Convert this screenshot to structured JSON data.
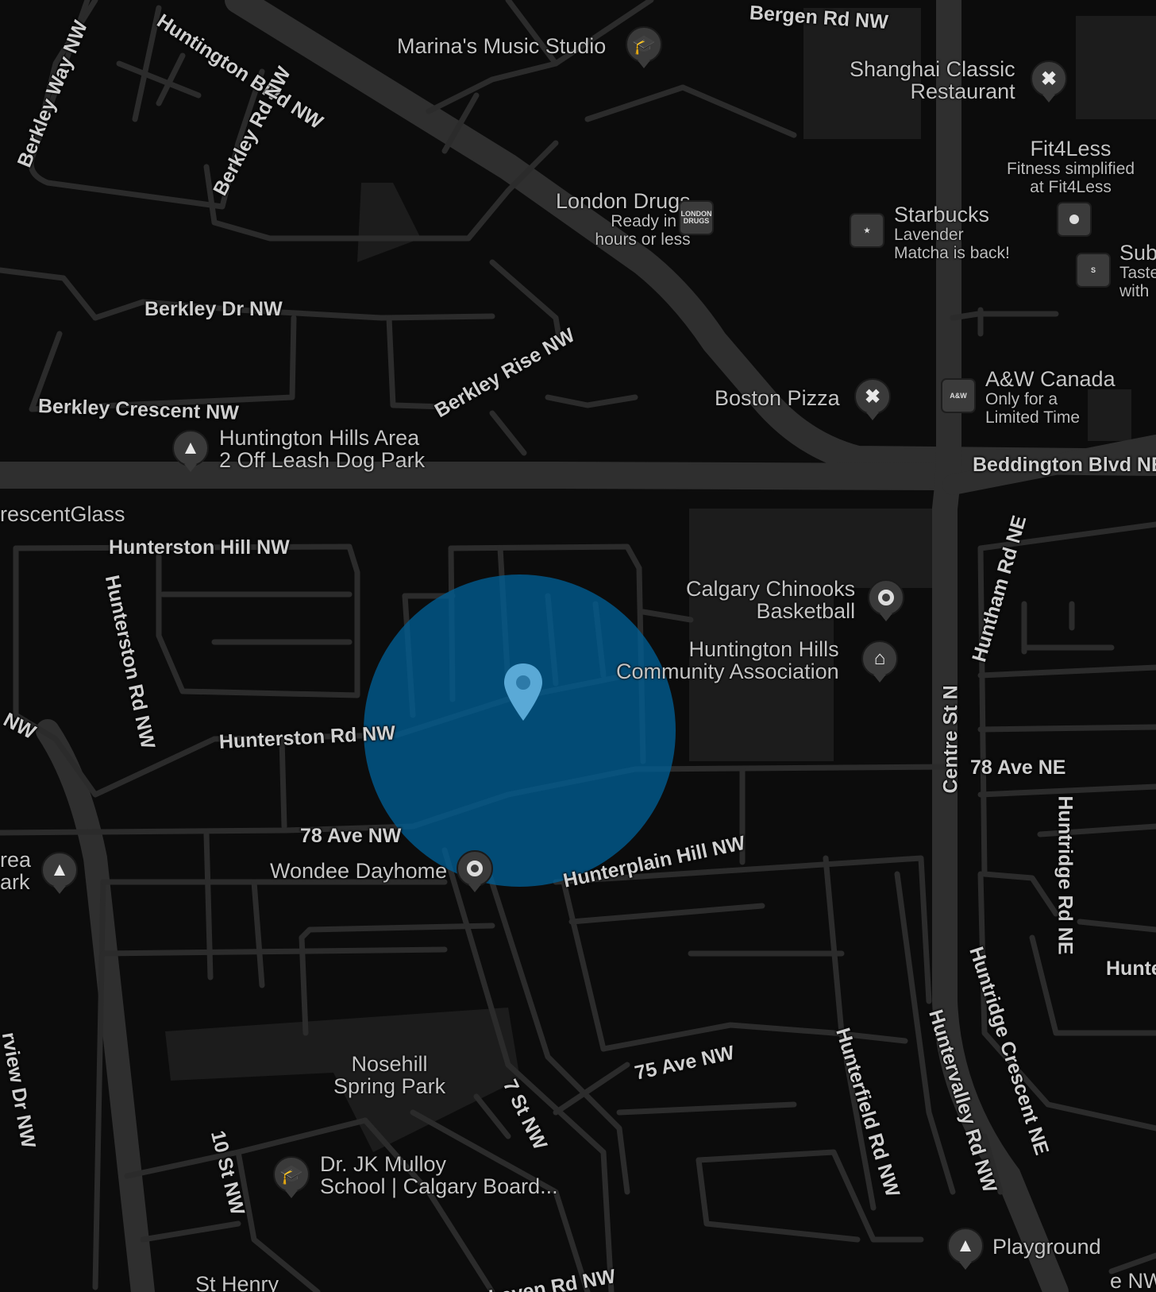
{
  "colors": {
    "background": "#0c0c0c",
    "road": "#262626",
    "arterial": "#2e2e2e",
    "block": "#1a1a1a",
    "accuracy_circle": "#005d94",
    "location_pin": "#5aa9d6",
    "label": "#cfcfcf"
  },
  "roads": {
    "huntington_blvd": "Huntington Blvd NW",
    "berkley_way": "Berkley Way NW",
    "berkley_rd": "Berkley Rd NW",
    "bergen_rd": "Bergen Rd NW",
    "berkley_dr": "Berkley Dr NW",
    "berkley_rise": "Berkley Rise NW",
    "berkley_crescent": "Berkley Crescent NW",
    "beddington_blvd": "Beddington Blvd NE",
    "hunterston_hill": "Hunterston Hill NW",
    "hunterston_rd_vertical": "Hunterston Rd NW",
    "hunterston_rd": "Hunterston Rd NW",
    "nw_fragment": "NW",
    "ave78_nw": "78 Ave NW",
    "hunterplain_hill": "Hunterplain Hill NW",
    "centre_st": "Centre St N",
    "ave78_ne": "78 Ave NE",
    "huntham_rd": "Huntham Rd NE",
    "huntridge_rd": "Huntridge Rd NE",
    "hunt_fragment": "Hunte",
    "huntridge_crescent": "Huntridge Crescent NE",
    "huntervalley_rd": "Huntervalley Rd NW",
    "hunterfield_rd": "Hunterfield Rd NW",
    "ave75_nw": "75 Ave NW",
    "st7_nw": "7 St NW",
    "st10_nw": "10 St NW",
    "hunterhaven_rd": "Hunterhaven Rd NW",
    "view_dr": "rview Dr NW"
  },
  "pois": {
    "marinas": {
      "name": "Marina's Music Studio",
      "icon": "graduation-cap-icon"
    },
    "shanghai": {
      "line1": "Shanghai Classic",
      "line2": "Restaurant",
      "icon": "restaurant-icon"
    },
    "fit4less": {
      "name": "Fit4Less",
      "line1": "Fitness simplified",
      "line2": "at Fit4Less",
      "icon": "generic-place-icon"
    },
    "london_drugs": {
      "name": "London Drugs",
      "line1": "Ready in 2",
      "line2": "hours or less",
      "logo": "LONDON DRUGS"
    },
    "starbucks": {
      "name": "Starbucks",
      "line1": "Lavender",
      "line2": "Matcha is back!",
      "icon": "starbucks-logo-icon"
    },
    "subway": {
      "name": "Sub",
      "line1": "Taste",
      "line2": "with",
      "icon": "subway-logo-icon"
    },
    "boston_pizza": {
      "name": "Boston Pizza",
      "icon": "restaurant-icon"
    },
    "aw": {
      "name": "A&W Canada",
      "line1": "Only for a",
      "line2": "Limited Time",
      "logo": "A&W"
    },
    "dog_park": {
      "line1": "Huntington Hills Area",
      "line2": "2 Off Leash Dog Park",
      "icon": "tree-icon"
    },
    "crescent_glass": {
      "name": "rescentGlass"
    },
    "chinooks": {
      "line1": "Calgary Chinooks",
      "line2": "Basketball",
      "icon": "place-dot-icon"
    },
    "community": {
      "line1": "Huntington Hills",
      "line2": "Community Association",
      "icon": "building-icon"
    },
    "area_park": {
      "line1": "rea",
      "line2": "ark",
      "icon": "tree-icon"
    },
    "wondee": {
      "name": "Wondee Dayhome",
      "icon": "place-dot-icon"
    },
    "nosehill": {
      "line1": "Nosehill",
      "line2": "Spring Park"
    },
    "mulloy": {
      "line1": "Dr. JK Mulloy",
      "line2": "School | Calgary Board...",
      "icon": "graduation-cap-icon"
    },
    "st_henry": {
      "name": "St Henry"
    },
    "playground": {
      "name": "Playground",
      "icon": "tree-icon"
    },
    "ne_fragment": {
      "name": "e NW"
    }
  }
}
